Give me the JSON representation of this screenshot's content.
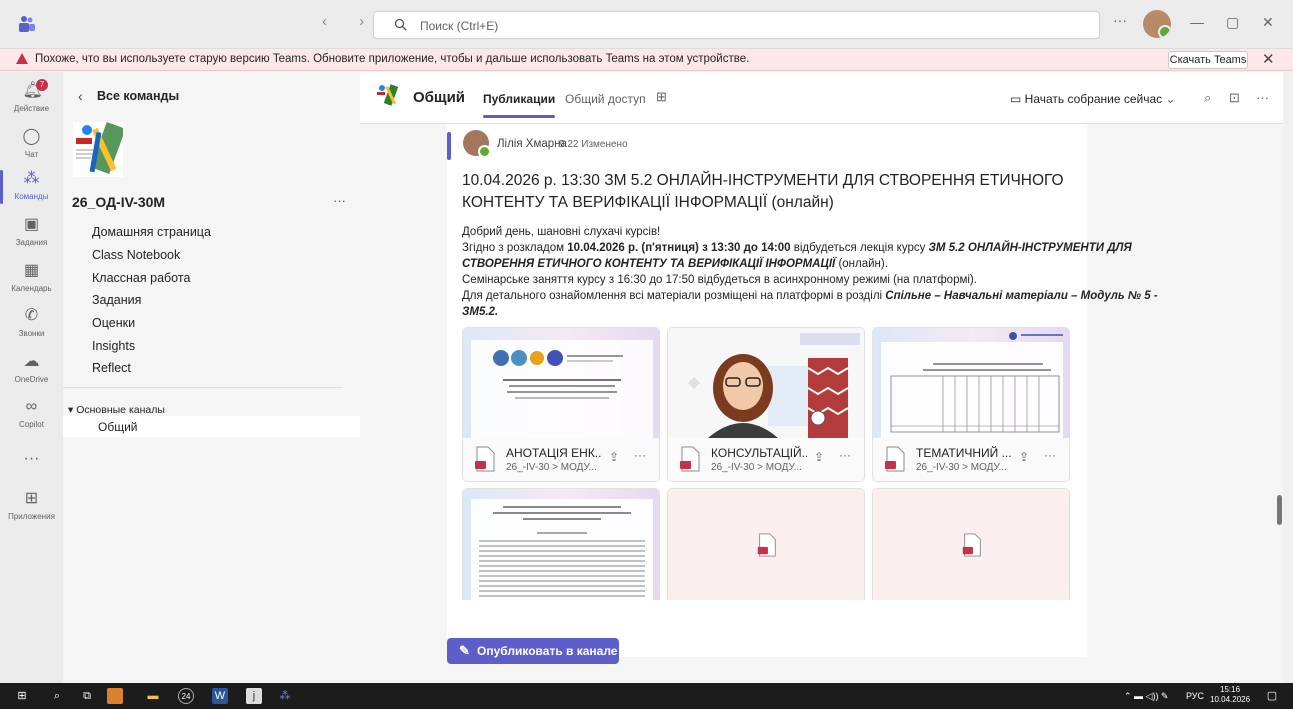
{
  "titlebar": {
    "search_placeholder": "Поиск (Ctrl+E)",
    "more": "···",
    "nav_arrows": "‹ ›"
  },
  "banner": {
    "message": "Похоже, что вы используете старую версию Teams. Обновите приложение, чтобы и дальше использовать Teams на этом устройстве.",
    "download_label": "Скачать Teams",
    "close": "✕"
  },
  "rail": [
    {
      "label": "Действие",
      "icon": "bell-icon",
      "badge": "7"
    },
    {
      "label": "Чат",
      "icon": "chat-icon"
    },
    {
      "label": "Команды",
      "icon": "teams-icon",
      "active": true
    },
    {
      "label": "Задания",
      "icon": "assignments-icon"
    },
    {
      "label": "Календарь",
      "icon": "calendar-icon"
    },
    {
      "label": "Звонки",
      "icon": "phone-icon"
    },
    {
      "label": "OneDrive",
      "icon": "onedrive-icon"
    },
    {
      "label": "Copilot",
      "icon": "copilot-icon"
    },
    {
      "label": "",
      "icon": "more-icon"
    },
    {
      "label": "Приложения",
      "icon": "apps-icon"
    }
  ],
  "sidebar": {
    "back_label": "Все команды",
    "team_name": "26_ОД-IV-30М",
    "team_more": "···",
    "items": [
      "Домашняя страница",
      "Class Notebook",
      "Классная работа",
      "Задания",
      "Оценки",
      "Insights",
      "Reflect"
    ],
    "section_label": "Основные каналы",
    "channel": "Общий"
  },
  "channel_header": {
    "title": "Общий",
    "tabs": [
      "Публикации",
      "Общий доступ"
    ],
    "meet_label": "Начать собрание сейчас"
  },
  "post": {
    "author": "Лілія Хмарна",
    "time": "9:22",
    "edited": "Изменено",
    "heading": "10.04.2026 р. 13:30 ЗМ 5.2 ОНЛАЙН-ІНСТРУМЕНТИ ДЛЯ СТВОРЕННЯ ЕТИЧНОГО КОНТЕНТУ ТА ВЕРИФІКАЦІЇ ІНФОРМАЦІЇ (онлайн)",
    "greeting": "Добрий день, шановні слухачі курсів!",
    "line2_a": "Згідно з розкладом ",
    "line2_b": "10.04.2026 р. (п'ятниця) з 13:30 до 14:00",
    "line2_c": " відбудеться лекція курсу ",
    "line2_d": "ЗМ 5.2 ОНЛАЙН-ІНСТРУМЕНТИ ДЛЯ СТВОРЕННЯ ЕТИЧНОГО КОНТЕНТУ ТА ВЕРИФІКАЦІЇ ІНФОРМАЦІЇ",
    "line2_e": " (онлайн).",
    "line3": "Семінарське заняття курсу з 16:30 до 17:50 відбудеться в асинхронному режимі (на платформі).",
    "line4_a": "Для детального ознайомлення всі матеріали розміщені на платформі в розділі ",
    "line4_b": "Спільне – Навчальні матеріали – Модуль № 5 - ЗМ5.2.",
    "attachments": [
      {
        "name": "АНОТАЦІЯ ЕНК....",
        "path": "26_-IV-30 > МОДУ..."
      },
      {
        "name": "КОНСУЛЬТАЦІЙ...",
        "path": "26_-IV-30 > МОДУ..."
      },
      {
        "name": "ТЕМАТИЧНИЙ ...",
        "path": "26_-IV-30 > МОДУ..."
      }
    ],
    "doc1_text": "НАЦІОНАЛЬНА АКАДЕМІЯ ПЕДАГОГІЧНИХ НАУК УКРАЇНИ",
    "doc3_text": "ТЕМАТИЧНИЙ ПЛАН ЛЕКЦІЙ ТА ЗАГОЛОВНИЙ МАТЕРІАЛ ЕЛЕКТРОННОГО НАВЧАЛЬНОГО КУРСУ",
    "doc4_text": "ТИПОВА ОСВІТНЯ ПРОГРАМА ЕЛЕКТРОННОГО КУРСУ «ОНЛАЙН-ІНСТРУМЕНТИ ДЛЯ СТВОРЕННЯ ЕТИЧНОГО КОНТЕНТУ ТА ВЕРИФІКАЦІЇ ІНФОРМАЦІЇ»"
  },
  "publish_label": "Опубликовать в канале",
  "taskbar": {
    "lang": "РУС",
    "time": "15:16",
    "date": "10.04.2026",
    "notif_count": "24"
  },
  "colors": {
    "accent": "#5b5fc7",
    "banner": "#fde7e9",
    "warn": "#c4314b"
  }
}
